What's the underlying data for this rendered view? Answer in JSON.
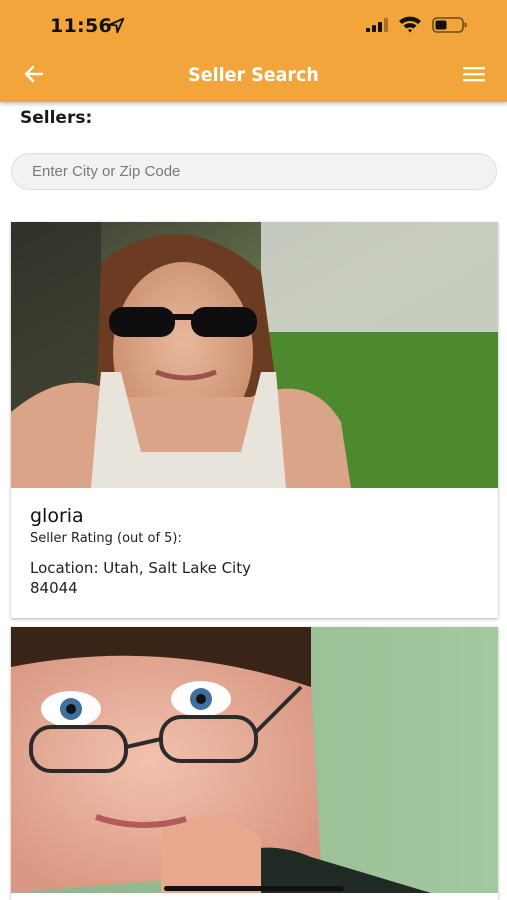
{
  "status_bar": {
    "time": "11:56"
  },
  "header": {
    "title": "Seller Search"
  },
  "section_label": "Sellers:",
  "search": {
    "placeholder": "Enter City or Zip Code"
  },
  "sellers": [
    {
      "name": "gloria",
      "rating_label": "Seller Rating (out of 5):",
      "location_line1": "Location: Utah, Salt Lake City",
      "location_line2": "84044"
    }
  ],
  "colors": {
    "header": "#f1a53a",
    "header_text": "#ffffff"
  },
  "icons": [
    "location-arrow-icon",
    "signal-icon",
    "wifi-icon",
    "battery-icon",
    "back-arrow-icon",
    "hamburger-menu-icon"
  ]
}
